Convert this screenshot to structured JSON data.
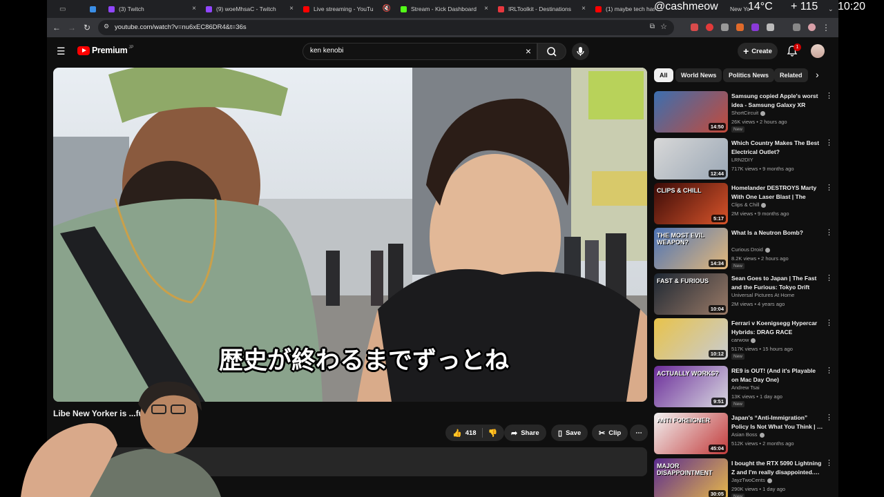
{
  "browser": {
    "tabs": [
      {
        "label": "",
        "color": "#3a8ee6"
      },
      {
        "label": "(3) Twitch",
        "color": "#9146ff"
      },
      {
        "label": "(9) woeMhsaC - Twitch",
        "color": "#9146ff"
      },
      {
        "label": "Live streaming - YouTu",
        "color": "#ff0000"
      },
      {
        "label": "Stream - Kick Dashboard",
        "color": "#53fc18"
      },
      {
        "label": "IRLToolkit - Destinations",
        "color": "#e8373e"
      },
      {
        "label": "(1) maybe tech has",
        "color": "#ff0000"
      },
      {
        "label": "New Yo",
        "color": "#ff0000"
      }
    ],
    "url": "youtube.com/watch?v=nu6xEC86DR4&t=36s"
  },
  "overlay": {
    "username": "@cashmeow",
    "temp": "14°C",
    "count": "+ 115",
    "time": "10:20"
  },
  "header": {
    "logo_text": "Premium",
    "logo_region": "JP",
    "search_value": "ken kenobi",
    "create_label": "Create",
    "notifications": "1"
  },
  "video": {
    "subtitle": "歴史が終わるまでずっとね",
    "title": "Libe   New Yorker is          ...full debate",
    "likes": "418",
    "share_label": "Share",
    "save_label": "Save",
    "clip_label": "Clip"
  },
  "chips": [
    "All",
    "World News",
    "Politics News",
    "Related"
  ],
  "related": [
    {
      "title": "Samsung copied Apple's worst idea - Samsung Galaxy XR",
      "channel": "ShortCircuit",
      "verified": true,
      "meta": "26K views • 2 hours ago",
      "new": "New",
      "duration": "14:50",
      "thumb": [
        "#3b6fb0",
        "#c44a3a"
      ]
    },
    {
      "title": "Which Country Makes The Best Electrical Outlet?",
      "channel": "LRN2DIY",
      "verified": false,
      "meta": "717K views • 9 months ago",
      "new": "",
      "duration": "12:44",
      "thumb": [
        "#d8d8d8",
        "#9aa7b5"
      ]
    },
    {
      "title": "Homelander DESTROYS Marty With One Laser Blast | The Boy…",
      "channel": "Clips & Chill",
      "verified": true,
      "meta": "2M views • 9 months ago",
      "new": "",
      "duration": "5:17",
      "thumb": [
        "#3a0b08",
        "#d9542a"
      ]
    },
    {
      "title": "What Is a Neutron Bomb?",
      "channel": "Curious Droid",
      "verified": true,
      "meta": "8.2K views • 2 hours ago",
      "new": "New",
      "duration": "14:34",
      "thumb": [
        "#4c73b6",
        "#e3b87a"
      ]
    },
    {
      "title": "Sean Goes to Japan | The Fast and the Furious: Tokyo Drift",
      "channel": "Universal Pictures At Home",
      "verified": false,
      "meta": "2M views • 4 years ago",
      "new": "",
      "duration": "10:04",
      "thumb": [
        "#1d2733",
        "#9a7a66"
      ]
    },
    {
      "title": "Ferrari v Koenigsegg Hypercar Hybrids: DRAG RACE",
      "channel": "carwow",
      "verified": true,
      "meta": "517K views • 15 hours ago",
      "new": "New",
      "duration": "10:12",
      "thumb": [
        "#e8c34a",
        "#c8cbd0"
      ]
    },
    {
      "title": "RE9 is OUT! (And it's Playable on Mac Day One)",
      "channel": "Andrew Tsai",
      "verified": false,
      "meta": "13K views • 1 day ago",
      "new": "New",
      "duration": "9:51",
      "thumb": [
        "#6b2c9a",
        "#d8d8e0"
      ]
    },
    {
      "title": "Japan's “Anti-Immigration” Policy Is Not What You Think | …",
      "channel": "Asian Boss",
      "verified": true,
      "meta": "512K views • 2 months ago",
      "new": "",
      "duration": "45:04",
      "thumb": [
        "#f2f2f2",
        "#c23b3b"
      ]
    },
    {
      "title": "I bought the RTX 5090 Lightning Z and I'm really disappointed.…",
      "channel": "JayzTwoCents",
      "verified": true,
      "meta": "290K views • 1 day ago",
      "new": "New",
      "duration": "30:05",
      "thumb": [
        "#5a2b8f",
        "#e8b94a"
      ]
    }
  ],
  "related_labels": {
    "thumb_texts": [
      "",
      "",
      "CLIPS & CHILL",
      "THE MOST EVIL WEAPON?",
      "FAST & FURIOUS",
      "",
      "ACTUALLY WORKS?",
      "ANTI FOREIGNER",
      "MAJOR DISAPPOINTMENT"
    ]
  }
}
